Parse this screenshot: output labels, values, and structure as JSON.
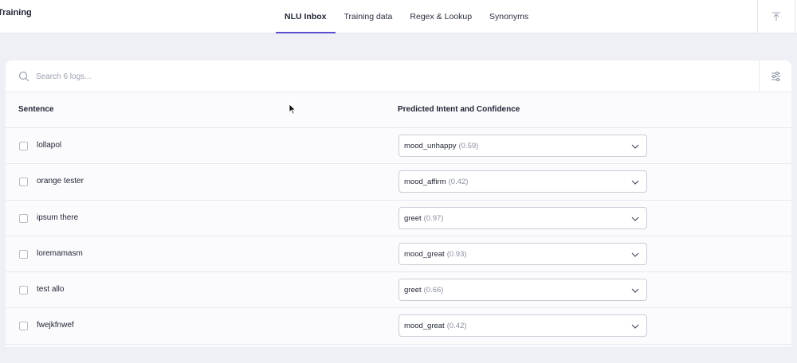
{
  "app": {
    "title": "Training"
  },
  "tabs": [
    {
      "label": "NLU Inbox",
      "active": true
    },
    {
      "label": "Training data",
      "active": false
    },
    {
      "label": "Regex & Lookup",
      "active": false
    },
    {
      "label": "Synonyms",
      "active": false
    }
  ],
  "header_actions": {
    "upload_icon": "upload-icon"
  },
  "search": {
    "placeholder": "Search 6 logs...",
    "value": ""
  },
  "table": {
    "columns": {
      "sentence": "Sentence",
      "intent": "Predicted Intent and Confidence"
    },
    "rows": [
      {
        "sentence": "lollapol",
        "intent": "mood_unhappy",
        "confidence": "(0.59)"
      },
      {
        "sentence": "orange tester",
        "intent": "mood_affirm",
        "confidence": "(0.42)"
      },
      {
        "sentence": "ipsum there",
        "intent": "greet",
        "confidence": "(0.97)"
      },
      {
        "sentence": "loremamasm",
        "intent": "mood_great",
        "confidence": "(0.93)"
      },
      {
        "sentence": "test allo",
        "intent": "greet",
        "confidence": "(0.66)"
      },
      {
        "sentence": "fwejkfnwef",
        "intent": "mood_great",
        "confidence": "(0.42)"
      }
    ]
  },
  "colors": {
    "accent": "#5a4fcf",
    "background": "#eef0f6"
  }
}
